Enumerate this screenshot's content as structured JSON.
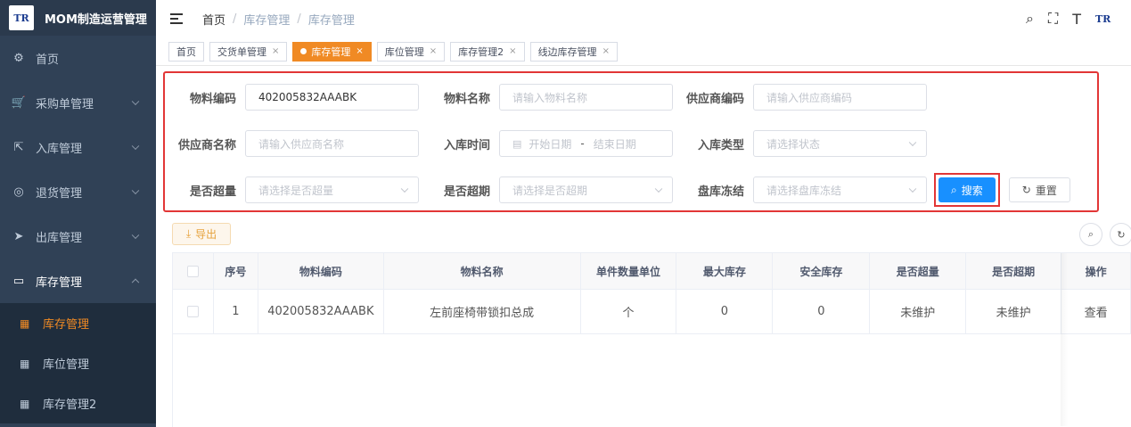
{
  "app": {
    "title": "MOM制造运营管理",
    "logo_text": "TR"
  },
  "sidebar": {
    "items": [
      {
        "label": "首页",
        "icon": "dashboard-icon",
        "glyph": "⚙"
      },
      {
        "label": "采购单管理",
        "icon": "cart-icon",
        "glyph": "🛒"
      },
      {
        "label": "入库管理",
        "icon": "external-link-icon",
        "glyph": "⇱"
      },
      {
        "label": "退货管理",
        "icon": "return-icon",
        "glyph": "◎"
      },
      {
        "label": "出库管理",
        "icon": "send-icon",
        "glyph": "➤"
      },
      {
        "label": "库存管理",
        "icon": "monitor-icon",
        "glyph": "▭"
      }
    ],
    "submenu": [
      {
        "label": "库存管理",
        "icon": "table-icon",
        "glyph": "▦"
      },
      {
        "label": "库位管理",
        "icon": "table-icon",
        "glyph": "▦"
      },
      {
        "label": "库存管理2",
        "icon": "table-icon",
        "glyph": "▦"
      }
    ]
  },
  "breadcrumb": [
    "首页",
    "库存管理",
    "库存管理"
  ],
  "nav_icons": {
    "search": "⌕",
    "fullscreen": "⛶",
    "font_size": "T",
    "brand": "TR"
  },
  "tags": [
    {
      "label": "首页",
      "closable": false
    },
    {
      "label": "交货单管理",
      "close": "×"
    },
    {
      "label": "库存管理",
      "close": "×",
      "active": true
    },
    {
      "label": "库位管理",
      "close": "×"
    },
    {
      "label": "库存管理2",
      "close": "×"
    },
    {
      "label": "线边库存管理",
      "close": "×"
    }
  ],
  "search_form": {
    "material_code": {
      "label": "物料编码",
      "value": "402005832AAABK"
    },
    "material_name": {
      "label": "物料名称",
      "placeholder": "请输入物料名称"
    },
    "supplier_code": {
      "label": "供应商编码",
      "placeholder": "请输入供应商编码"
    },
    "supplier_name": {
      "label": "供应商名称",
      "placeholder": "请输入供应商名称"
    },
    "inbound_time": {
      "label": "入库时间",
      "start_placeholder": "开始日期",
      "separator": "-",
      "end_placeholder": "结束日期"
    },
    "inbound_type": {
      "label": "入库类型",
      "placeholder": "请选择状态"
    },
    "over_qty": {
      "label": "是否超量",
      "placeholder": "请选择是否超量"
    },
    "over_time": {
      "label": "是否超期",
      "placeholder": "请选择是否超期"
    },
    "stock_freeze": {
      "label": "盘库冻结",
      "placeholder": "请选择盘库冻结"
    },
    "search_button": "搜索",
    "reset_button": "重置"
  },
  "toolbar": {
    "export_label": "导出"
  },
  "table": {
    "columns": [
      "序号",
      "物料编码",
      "物料名称",
      "单件数量单位",
      "最大库存",
      "安全库存",
      "是否超量",
      "是否超期",
      "操作"
    ],
    "rows": [
      {
        "index": "1",
        "material_code": "402005832AAABK",
        "material_name": "左前座椅带锁扣总成",
        "unit": "个",
        "max_stock": "0",
        "safety_stock": "0",
        "over_qty": "未维护",
        "over_time": "未维护",
        "action": "查看"
      }
    ]
  },
  "colors": {
    "sidebar_bg": "#304156",
    "accent": "#f08a24",
    "primary": "#1890ff",
    "highlight_border": "#e23636"
  }
}
